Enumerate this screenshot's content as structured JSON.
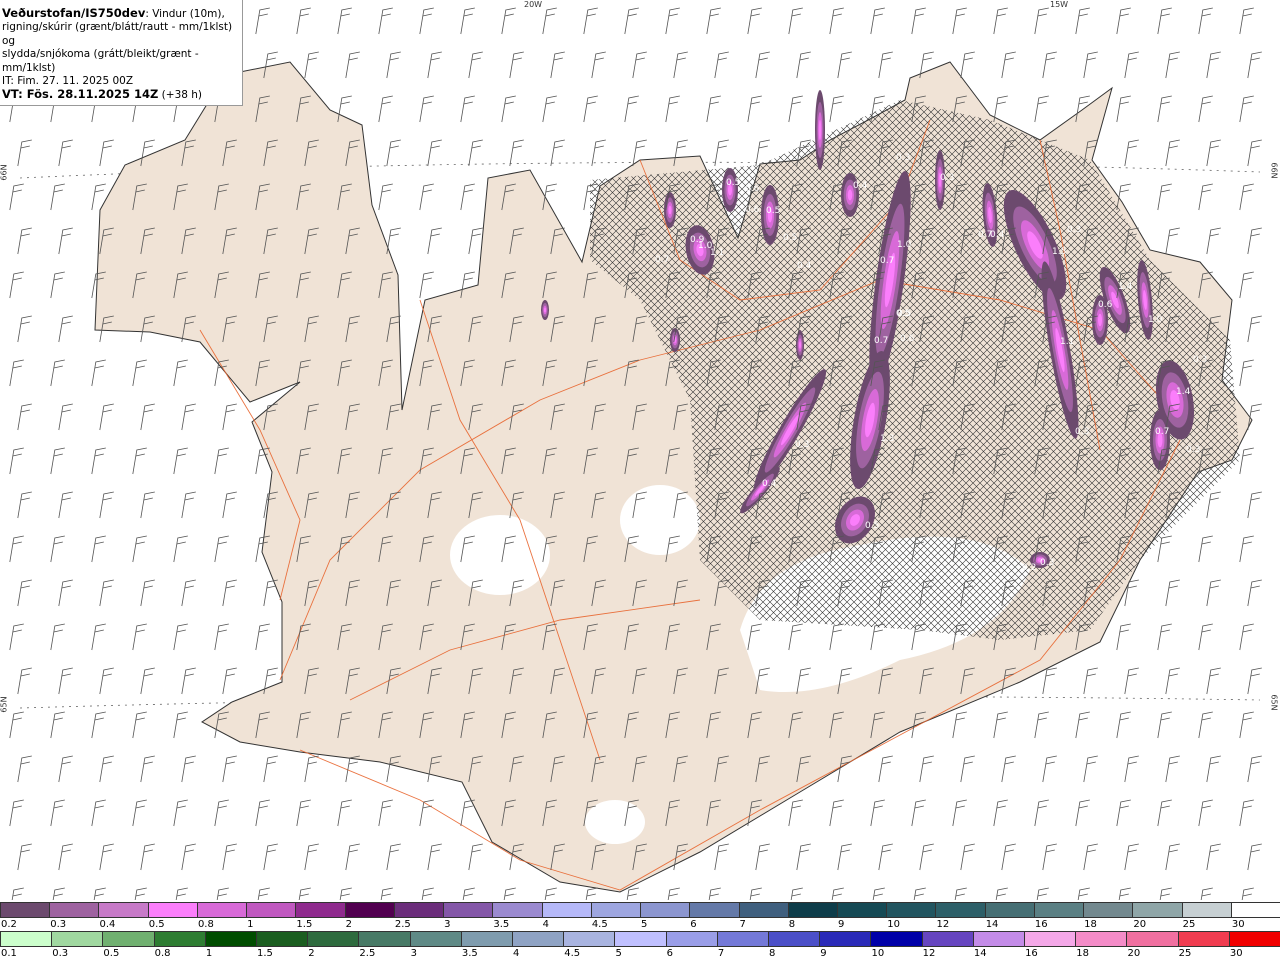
{
  "header": {
    "source": "Veðurstofan/IS750dev",
    "desc1": ": Vindur (10m),",
    "desc2": "rigning/skúrir (grænt/blátt/rautt - mm/1klst) og",
    "desc3": "slydda/snjókoma (grátt/bleikt/grænt - mm/1klst)",
    "init_time": "IT: Fim. 27. 11. 2025 00Z",
    "valid_label": "VT: Fös. 28.11.2025 14Z",
    "lead": "(+38 h)"
  },
  "map": {
    "graticule": {
      "top": [
        "20W",
        "15W"
      ],
      "left": [
        "66N",
        "65N"
      ],
      "right": [
        "66N",
        "65N"
      ]
    },
    "colors": {
      "land": "#f0e3d6",
      "glacier": "#ffffff",
      "sea": "#ffffff",
      "roads": "#e8652e",
      "coast": "#333333",
      "wind_barb": "#555555",
      "hatch": "#333333"
    },
    "contour_labels": [
      "0.5",
      "0.6",
      "0.6",
      "0.5",
      "0.5",
      "0.4",
      "1.0",
      "0.9",
      "1.1",
      "0.7",
      "0.4",
      "0.3",
      "0.3",
      "1.0",
      "0.7",
      "0.5",
      "0.7",
      "0.6",
      "1.3",
      "0.4",
      "0.3",
      "0.5",
      "0.5",
      "0.7",
      "1.5",
      "0.4",
      "0.3",
      "1.4",
      "0.6",
      "1.0",
      "1.1",
      "0.3",
      "0.3",
      "1.4",
      "0.7",
      "0.3",
      "0.3",
      "0.2"
    ]
  },
  "legend_sleet_snow": {
    "labels": [
      "0.2",
      "0.3",
      "0.4",
      "0.5",
      "0.8",
      "1",
      "1.5",
      "2",
      "2.5",
      "3",
      "3.5",
      "4",
      "4.5",
      "5",
      "6",
      "7",
      "8",
      "9",
      "10",
      "12",
      "14",
      "16",
      "18",
      "20",
      "25",
      "30"
    ],
    "colors": [
      "#6c4a6e",
      "#9e62a0",
      "#c77ac8",
      "#fb7efb",
      "#d86ad8",
      "#c058c0",
      "#8f2a8e",
      "#520050",
      "#6b2d7b",
      "#8457a8",
      "#9b8ad0",
      "#b5b8f8",
      "#9ea6e0",
      "#8c96d0",
      "#6479a8",
      "#3f5f7e",
      "#0e3d4a",
      "#164a55",
      "#225560",
      "#2d5f68",
      "#466f74",
      "#5b8084",
      "#73898f",
      "#8fa6a8",
      "#c6cfd2",
      "#ffffff"
    ]
  },
  "legend_rain": {
    "labels": [
      "0.1",
      "0.3",
      "0.5",
      "0.8",
      "1",
      "1.5",
      "2",
      "2.5",
      "3",
      "3.5",
      "4",
      "4.5",
      "5",
      "6",
      "7",
      "8",
      "9",
      "10",
      "12",
      "14",
      "16",
      "18",
      "20",
      "25",
      "30"
    ],
    "colors": [
      "#ccffcc",
      "#a0d8a0",
      "#70b070",
      "#2e7d32",
      "#004d00",
      "#1b5e20",
      "#2e6b3e",
      "#487a66",
      "#5f8a86",
      "#7f9cae",
      "#8fa3c4",
      "#a9b4e0",
      "#c0c0ff",
      "#9a9ee8",
      "#7479d8",
      "#4b4fc8",
      "#2a2ab8",
      "#0000a8",
      "#6645c0",
      "#c48ce8",
      "#f4a8e8",
      "#f48cc8",
      "#f070a0",
      "#f03c50",
      "#f00000"
    ]
  }
}
